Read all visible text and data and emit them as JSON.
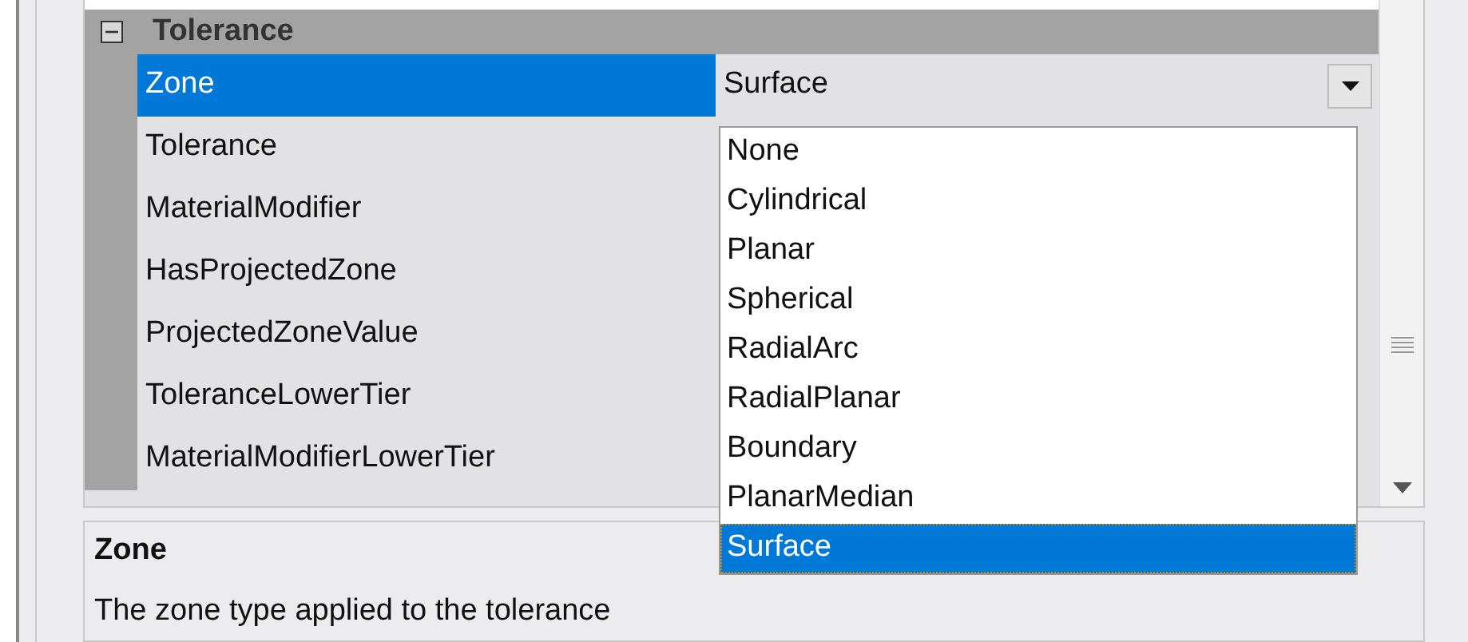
{
  "category": {
    "title": "Tolerance",
    "expanded": true
  },
  "properties": [
    {
      "name": "Zone",
      "value": "Surface",
      "selected": true
    },
    {
      "name": "Tolerance",
      "selected": false
    },
    {
      "name": "MaterialModifier",
      "selected": false
    },
    {
      "name": "HasProjectedZone",
      "selected": false
    },
    {
      "name": "ProjectedZoneValue",
      "selected": false
    },
    {
      "name": "ToleranceLowerTier",
      "selected": false
    },
    {
      "name": "MaterialModifierLowerTier",
      "selected": false
    }
  ],
  "dropdown": {
    "options": [
      {
        "label": "None",
        "selected": false
      },
      {
        "label": "Cylindrical",
        "selected": false
      },
      {
        "label": "Planar",
        "selected": false
      },
      {
        "label": "Spherical",
        "selected": false
      },
      {
        "label": "RadialArc",
        "selected": false
      },
      {
        "label": "RadialPlanar",
        "selected": false
      },
      {
        "label": "Boundary",
        "selected": false
      },
      {
        "label": "PlanarMedian",
        "selected": false
      },
      {
        "label": "Surface",
        "selected": true
      }
    ]
  },
  "description": {
    "title": "Zone",
    "text": "The zone type applied to the tolerance"
  }
}
